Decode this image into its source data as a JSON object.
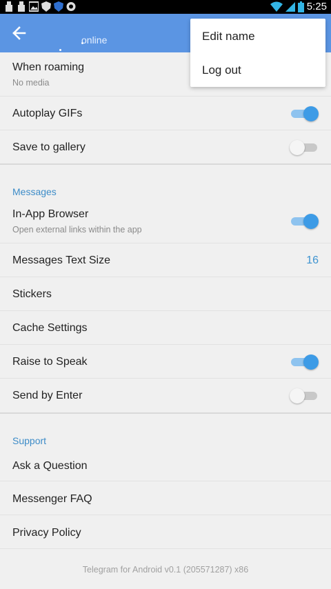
{
  "status_bar": {
    "time": "5:25",
    "left_icons": [
      "usb-icon",
      "usb-icon",
      "image-icon",
      "shield-icon",
      "shield-icon",
      "shield-icon"
    ],
    "right_icons": [
      "wifi-icon",
      "signal-icon",
      "battery-icon"
    ]
  },
  "action_bar": {
    "subtitle": "online",
    "background_color": "#5b95e3"
  },
  "overflow_menu": {
    "items": [
      {
        "label": "Edit name"
      },
      {
        "label": "Log out"
      }
    ]
  },
  "settings": {
    "when_roaming": {
      "title": "When roaming",
      "subtitle": "No media"
    },
    "autoplay_gifs": {
      "title": "Autoplay GIFs",
      "enabled": true
    },
    "save_to_gallery": {
      "title": "Save to gallery",
      "enabled": false
    },
    "messages_section": {
      "title": "Messages"
    },
    "in_app_browser": {
      "title": "In-App Browser",
      "subtitle": "Open external links within the app",
      "enabled": true
    },
    "messages_text_size": {
      "title": "Messages Text Size",
      "value": "16"
    },
    "stickers": {
      "title": "Stickers"
    },
    "cache_settings": {
      "title": "Cache Settings"
    },
    "raise_to_speak": {
      "title": "Raise to Speak",
      "enabled": true
    },
    "send_by_enter": {
      "title": "Send by Enter",
      "enabled": false
    },
    "support_section": {
      "title": "Support"
    },
    "ask_question": {
      "title": "Ask a Question"
    },
    "faq": {
      "title": "Messenger FAQ"
    },
    "privacy_policy": {
      "title": "Privacy Policy"
    }
  },
  "footer": {
    "version_text": "Telegram for Android v0.1 (205571287) x86"
  },
  "colors": {
    "accent": "#3d93d0",
    "toggle_on": "#3d9be6",
    "background": "#f0f0f0"
  }
}
